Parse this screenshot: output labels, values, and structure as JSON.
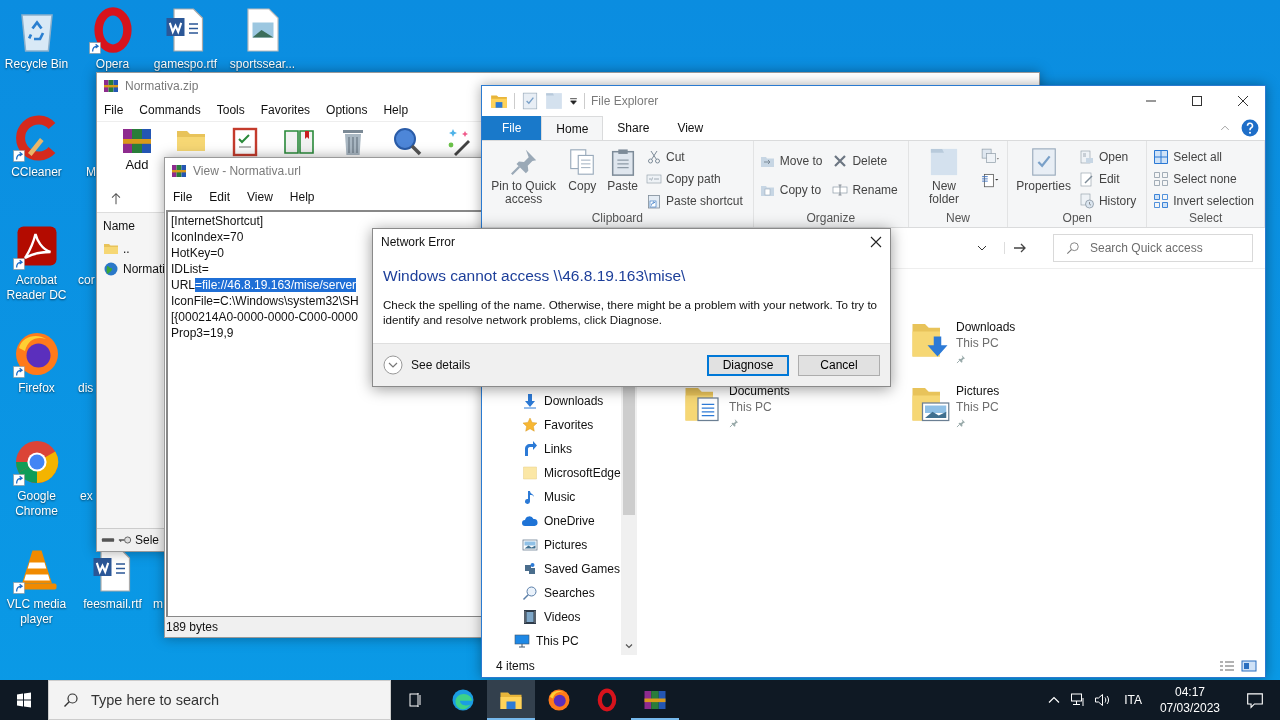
{
  "desktop": {
    "icons": [
      {
        "label": "Recycle Bin",
        "kind": "recycle",
        "shortcut": false
      },
      {
        "label": "Opera",
        "kind": "opera",
        "shortcut": true
      },
      {
        "label": "gamespo.rtf",
        "kind": "word",
        "shortcut": false
      },
      {
        "label": "sportssear...",
        "kind": "imagedoc",
        "shortcut": false
      },
      {
        "label": "CCleaner",
        "kind": "ccleaner",
        "shortcut": true
      },
      {
        "label": "Acrobat Reader DC",
        "kind": "acrobat",
        "shortcut": true
      },
      {
        "label": "Firefox",
        "kind": "firefox",
        "shortcut": true
      },
      {
        "label": "Google Chrome",
        "kind": "chrome",
        "shortcut": true
      },
      {
        "label": "VLC media player",
        "kind": "vlc",
        "shortcut": true
      },
      {
        "label": "feesmail.rtf",
        "kind": "word",
        "shortcut": false
      }
    ],
    "partial_labels": [
      "M",
      "cor",
      "dis",
      "ex",
      "m"
    ]
  },
  "winrar": {
    "title": "Normativa.zip",
    "menu": [
      "File",
      "Commands",
      "Tools",
      "Favorites",
      "Options",
      "Help"
    ],
    "toolbar": [
      {
        "label": "Add",
        "kind": "winrar"
      },
      {
        "kind": "folder"
      },
      {
        "kind": "clipboard"
      },
      {
        "kind": "book"
      },
      {
        "kind": "trash"
      },
      {
        "kind": "magnifier"
      },
      {
        "kind": "wand"
      }
    ],
    "column": "Name",
    "files": [
      {
        "name": "..",
        "kind": "folder"
      },
      {
        "name": "Normati",
        "kind": "globe"
      }
    ],
    "status": "Sele"
  },
  "viewer": {
    "title": "View - Normativa.url",
    "menu": [
      "File",
      "Edit",
      "View",
      "Help"
    ],
    "lines": [
      {
        "segments": [
          {
            "text": "[InternetShortcut]",
            "selected": false
          }
        ]
      },
      {
        "segments": [
          {
            "text": "IconIndex=70",
            "selected": false
          }
        ]
      },
      {
        "segments": [
          {
            "text": "HotKey=0",
            "selected": false
          }
        ]
      },
      {
        "segments": [
          {
            "text": "IDList=",
            "selected": false
          }
        ]
      },
      {
        "segments": [
          {
            "text": "URL",
            "selected": false
          },
          {
            "text": "=file://46.8.19.163/mise/server",
            "selected": true
          }
        ]
      },
      {
        "segments": [
          {
            "text": "IconFile=C:\\Windows\\system32\\SH",
            "selected": false
          }
        ]
      },
      {
        "segments": [
          {
            "text": "[{000214A0-0000-0000-C000-0000",
            "selected": false
          }
        ]
      },
      {
        "segments": [
          {
            "text": "Prop3=19,9",
            "selected": false
          }
        ]
      }
    ],
    "status": "189 bytes"
  },
  "explorer": {
    "title": "File Explorer",
    "tabs": [
      {
        "label": "File",
        "kind": "file",
        "selected": false
      },
      {
        "label": "Home",
        "kind": "tab",
        "selected": true
      },
      {
        "label": "Share",
        "kind": "tab",
        "selected": false
      },
      {
        "label": "View",
        "kind": "tab",
        "selected": false
      }
    ],
    "ribbon": [
      {
        "label": "Clipboard",
        "commands": [
          {
            "label": "Pin to Quick access",
            "kind": "large"
          },
          {
            "label": "Copy",
            "kind": "large"
          },
          {
            "label": "Paste",
            "kind": "large"
          },
          {
            "label": "Cut",
            "kind": "small"
          },
          {
            "label": "Copy path",
            "kind": "small"
          },
          {
            "label": "Paste shortcut",
            "kind": "small"
          }
        ]
      },
      {
        "label": "Organize",
        "commands": [
          {
            "label": "Move to",
            "kind": "small"
          },
          {
            "label": "Copy to",
            "kind": "small"
          },
          {
            "label": "Delete",
            "kind": "small"
          },
          {
            "label": "Rename",
            "kind": "small"
          }
        ]
      },
      {
        "label": "New",
        "commands": [
          {
            "label": "New folder",
            "kind": "large"
          },
          {
            "kind": "icon"
          },
          {
            "kind": "icon"
          }
        ]
      },
      {
        "label": "Open",
        "commands": [
          {
            "label": "Properties",
            "kind": "large"
          },
          {
            "label": "Open",
            "kind": "small"
          },
          {
            "label": "Edit",
            "kind": "small"
          },
          {
            "label": "History",
            "kind": "small"
          }
        ]
      },
      {
        "label": "Select",
        "commands": [
          {
            "label": "Select all",
            "kind": "small"
          },
          {
            "label": "Select none",
            "kind": "small"
          },
          {
            "label": "Invert selection",
            "kind": "small"
          }
        ]
      }
    ],
    "search": {
      "placeholder": "Search Quick access"
    },
    "nav": [
      {
        "children": [
          {
            "label": "Downloads",
            "kind": "download"
          },
          {
            "label": "Favorites",
            "kind": "star"
          },
          {
            "label": "Links",
            "kind": "link"
          },
          {
            "label": "MicrosoftEdge",
            "kind": "folderpale"
          },
          {
            "label": "Music",
            "kind": "music"
          },
          {
            "label": "OneDrive",
            "kind": "cloud"
          },
          {
            "label": "Pictures",
            "kind": "picture"
          },
          {
            "label": "Saved Games",
            "kind": "game"
          },
          {
            "label": "Searches",
            "kind": "searches"
          },
          {
            "label": "Videos",
            "kind": "video"
          }
        ]
      },
      {
        "label": "This PC",
        "kind": "pc"
      }
    ],
    "items": [
      {
        "name": "Downloads",
        "location": "This PC",
        "kind": "dlfolder"
      },
      {
        "name": "Documents",
        "location": "This PC",
        "kind": "docfolder"
      },
      {
        "name": "Pictures",
        "location": "This PC",
        "kind": "picfolder"
      }
    ],
    "status": "4 items"
  },
  "dialog": {
    "title": "Network Error",
    "heading": "Windows cannot access \\\\46.8.19.163\\mise\\",
    "message": "Check the spelling of the name. Otherwise, there might be a problem with your network. To try to identify and resolve network problems, click Diagnose.",
    "details": "See details",
    "buttons": [
      {
        "label": "Diagnose",
        "default": true
      },
      {
        "label": "Cancel",
        "default": false
      }
    ]
  },
  "taskbar": {
    "search": {
      "placeholder": "Type here to search"
    },
    "apps": [
      {
        "kind": "edge",
        "running": false,
        "selected": false
      },
      {
        "kind": "explorer",
        "running": true,
        "selected": true
      },
      {
        "kind": "firefox",
        "running": false,
        "selected": false
      },
      {
        "kind": "opera",
        "running": false,
        "selected": false
      },
      {
        "kind": "winrar",
        "running": true,
        "selected": false
      }
    ],
    "language": "ITA",
    "time": "04:17",
    "date": "07/03/2023"
  }
}
